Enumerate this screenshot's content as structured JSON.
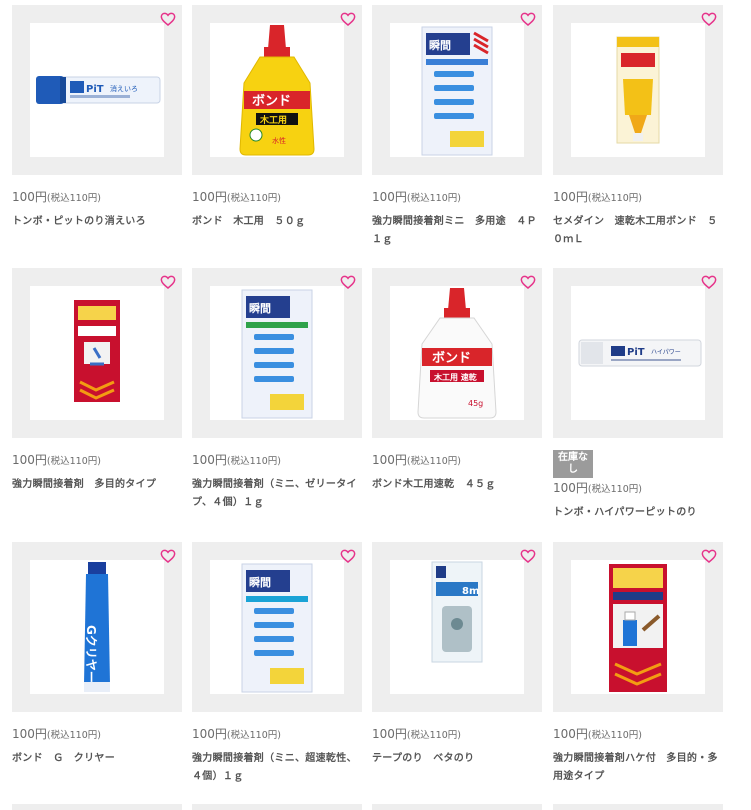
{
  "colors": {
    "heart": "#e6338a",
    "card_bg": "#eeeeee",
    "badge_bg": "#9b9b9b"
  },
  "products": [
    {
      "price": "100円",
      "tax": "(税込110円)",
      "name": "トンボ・ピットのり消えいろ",
      "image": "pit-glue-stick-blue",
      "badge": ""
    },
    {
      "price": "100円",
      "tax": "(税込110円)",
      "name": "ボンド　木工用　５０ｇ",
      "image": "bond-wood-glue-yellow",
      "badge": ""
    },
    {
      "price": "100円",
      "tax": "(税込110円)",
      "name": "強力瞬間接着剤ミニ　多用途　４Ｐ　１ｇ",
      "image": "super-glue-mini-4pack",
      "badge": ""
    },
    {
      "price": "100円",
      "tax": "(税込110円)",
      "name": "セメダイン　速乾木工用ボンド　５０ｍＬ",
      "image": "cemedine-wood-bond",
      "badge": ""
    },
    {
      "price": "100円",
      "tax": "(税込110円)",
      "name": "強力瞬間接着剤　多目的タイプ",
      "image": "super-glue-multipurpose",
      "badge": ""
    },
    {
      "price": "100円",
      "tax": "(税込110円)",
      "name": "強力瞬間接着剤（ミニ、ゼリータイプ、４個）１ｇ",
      "image": "super-glue-jelly-4pack",
      "badge": ""
    },
    {
      "price": "100円",
      "tax": "(税込110円)",
      "name": "ボンド木工用速乾　４５ｇ",
      "image": "bond-wood-quick-white",
      "badge": ""
    },
    {
      "price": "100円",
      "tax": "(税込110円)",
      "name": "トンボ・ハイパワーピットのり",
      "image": "pit-high-power-white",
      "badge": "在庫なし"
    },
    {
      "price": "100円",
      "tax": "(税込110円)",
      "name": "ボンド　Ｇ　クリヤー",
      "image": "bond-g-clear-tube",
      "badge": ""
    },
    {
      "price": "100円",
      "tax": "(税込110円)",
      "name": "強力瞬間接着剤（ミニ、超速乾性、４個）１ｇ",
      "image": "super-glue-ultrafast-4pack",
      "badge": ""
    },
    {
      "price": "100円",
      "tax": "(税込110円)",
      "name": "テープのり　ベタのり",
      "image": "tape-glue-compact",
      "badge": ""
    },
    {
      "price": "100円",
      "tax": "(税込110円)",
      "name": "強力瞬間接着剤ハケ付　多目的・多用途タイプ",
      "image": "super-glue-brush",
      "badge": ""
    }
  ]
}
